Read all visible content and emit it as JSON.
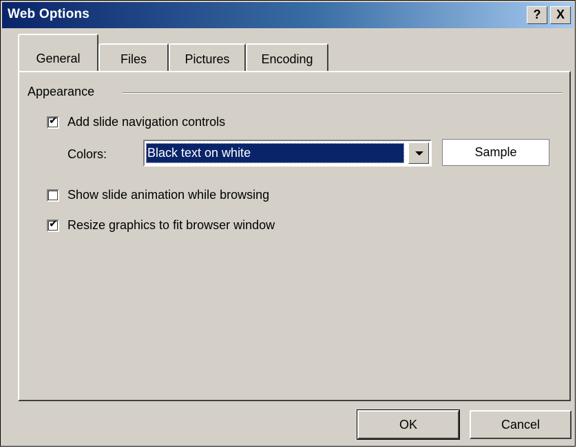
{
  "window": {
    "title": "Web Options",
    "help_glyph": "?",
    "close_glyph": "X"
  },
  "tabs": [
    {
      "label": "General",
      "active": true
    },
    {
      "label": "Files",
      "active": false
    },
    {
      "label": "Pictures",
      "active": false
    },
    {
      "label": "Encoding",
      "active": false
    }
  ],
  "appearance": {
    "group_label": "Appearance",
    "nav_controls": {
      "label": "Add slide navigation controls",
      "checked": true
    },
    "colors": {
      "label": "Colors:",
      "selected_value": "Black text on white",
      "sample_label": "Sample"
    },
    "animation": {
      "label": "Show slide animation while browsing",
      "checked": false
    },
    "resize": {
      "label": "Resize graphics to fit browser window",
      "checked": true
    }
  },
  "buttons": {
    "ok": "OK",
    "cancel": "Cancel"
  },
  "checkmark_glyph": "✔",
  "accent_color": "#0a246a"
}
